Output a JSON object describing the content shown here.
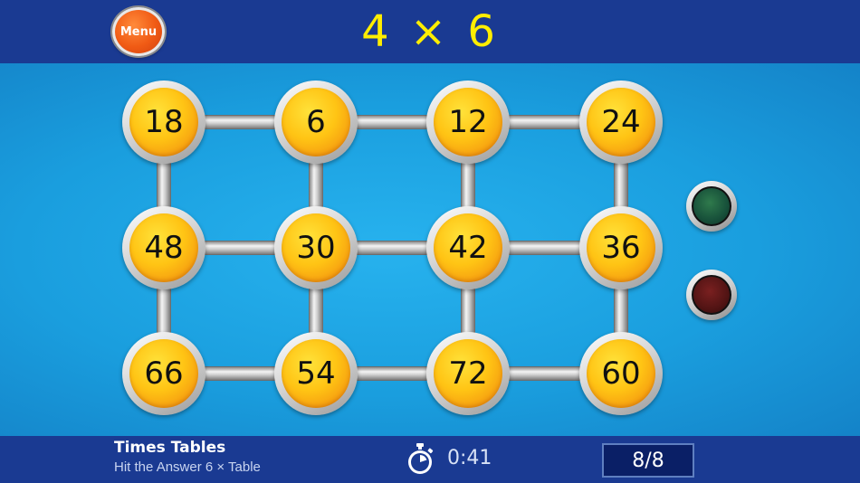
{
  "header": {
    "menu_label": "Menu",
    "question": "4 × 6"
  },
  "board": {
    "rows": [
      [
        "18",
        "6",
        "12",
        "24"
      ],
      [
        "48",
        "30",
        "42",
        "36"
      ],
      [
        "66",
        "54",
        "72",
        "60"
      ]
    ]
  },
  "indicators": {
    "green_light": "green-light-icon",
    "red_light": "red-light-icon"
  },
  "footer": {
    "title": "Times Tables",
    "subtitle": "Hit the Answer 6 × Table",
    "timer": "0:41",
    "score": "8/8",
    "timer_icon": "stopwatch-icon"
  },
  "colors": {
    "bar": "#1a3a92",
    "background": "#1e9fe0",
    "question_text": "#ffee00",
    "node_fill": "#ffc414",
    "menu_button": "#f05a14"
  }
}
